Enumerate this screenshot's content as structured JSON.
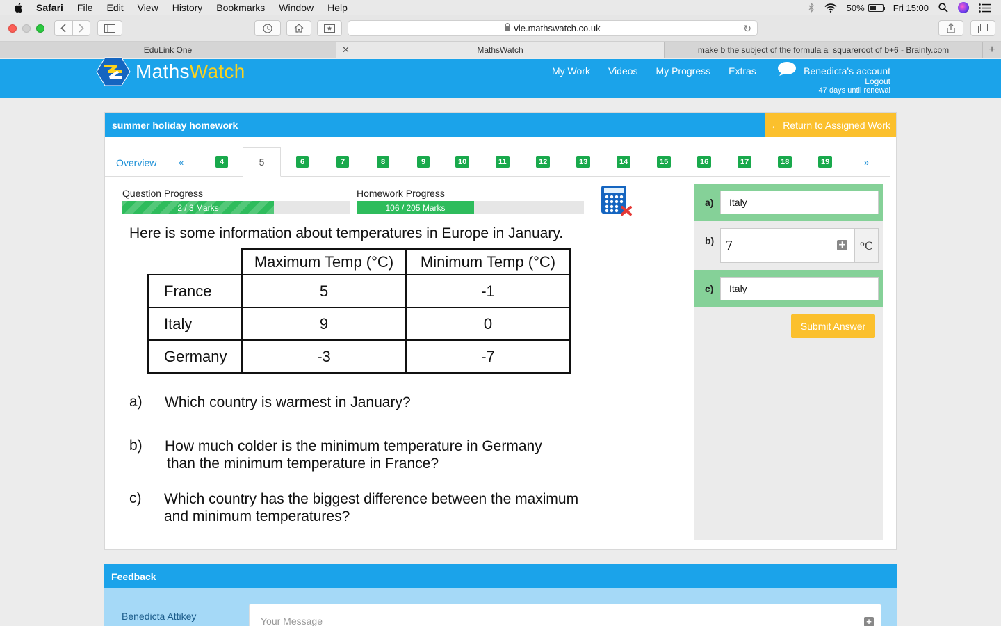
{
  "menubar": {
    "app": "Safari",
    "items": [
      "File",
      "Edit",
      "View",
      "History",
      "Bookmarks",
      "Window",
      "Help"
    ],
    "battery": "50%",
    "clock": "Fri 15:00"
  },
  "browser": {
    "url": "vle.mathswatch.co.uk",
    "tabs": [
      {
        "title": "EduLink One"
      },
      {
        "title": "MathsWatch"
      },
      {
        "title": "make b the subject of the formula a=squareroot of b+6 - Brainly.com"
      }
    ]
  },
  "site": {
    "logo_main": "Maths",
    "logo_accent": "Watch",
    "nav": [
      "My Work",
      "Videos",
      "My Progress",
      "Extras"
    ],
    "account_name": "Benedicta's account",
    "logout": "Logout",
    "renewal": "47 days until renewal"
  },
  "homework": {
    "title": "summer holiday homework",
    "return_label": "Return to Assigned Work",
    "overview": "Overview",
    "prev": "«",
    "next": "»",
    "current_question": "5",
    "question_numbers": [
      "4",
      "6",
      "7",
      "8",
      "9",
      "10",
      "11",
      "12",
      "13",
      "14",
      "15",
      "16",
      "17",
      "18",
      "19"
    ],
    "question_progress_label": "Question Progress",
    "question_progress_text": "2 / 3 Marks",
    "question_progress_fraction": 0.667,
    "homework_progress_label": "Homework Progress",
    "homework_progress_text": "106 / 205 Marks",
    "homework_progress_fraction": 0.517
  },
  "question": {
    "intro": "Here is some information about temperatures in Europe in January.",
    "col_max": "Maximum Temp (°C)",
    "col_min": "Minimum Temp (°C)",
    "rows": [
      {
        "country": "France",
        "max": "5",
        "min": "-1"
      },
      {
        "country": "Italy",
        "max": "9",
        "min": "0"
      },
      {
        "country": "Germany",
        "max": "-3",
        "min": "-7"
      }
    ],
    "parts": [
      {
        "label": "a)",
        "line1": "Which country is warmest in January?",
        "line2": ""
      },
      {
        "label": "b)",
        "line1": "How much colder is the minimum temperature in Germany",
        "line2": "than the minimum temperature in France?"
      },
      {
        "label": "c)",
        "line1": "Which country has the biggest difference between the maximum",
        "line2": "and minimum temperatures?"
      }
    ]
  },
  "answers": {
    "a_label": "a)",
    "a_value": "Italy",
    "b_label": "b)",
    "b_value": "7",
    "b_unit": "C",
    "c_label": "c)",
    "c_value": "Italy",
    "submit": "Submit Answer",
    "correct_color": "#85d198"
  },
  "feedback": {
    "title": "Feedback",
    "name": "Benedicta Attikey",
    "placeholder": "Your Message"
  },
  "colors": {
    "brand_blue": "#1ba3ea",
    "accent_yellow": "#fbc02d",
    "badge_green": "#19a94c"
  }
}
